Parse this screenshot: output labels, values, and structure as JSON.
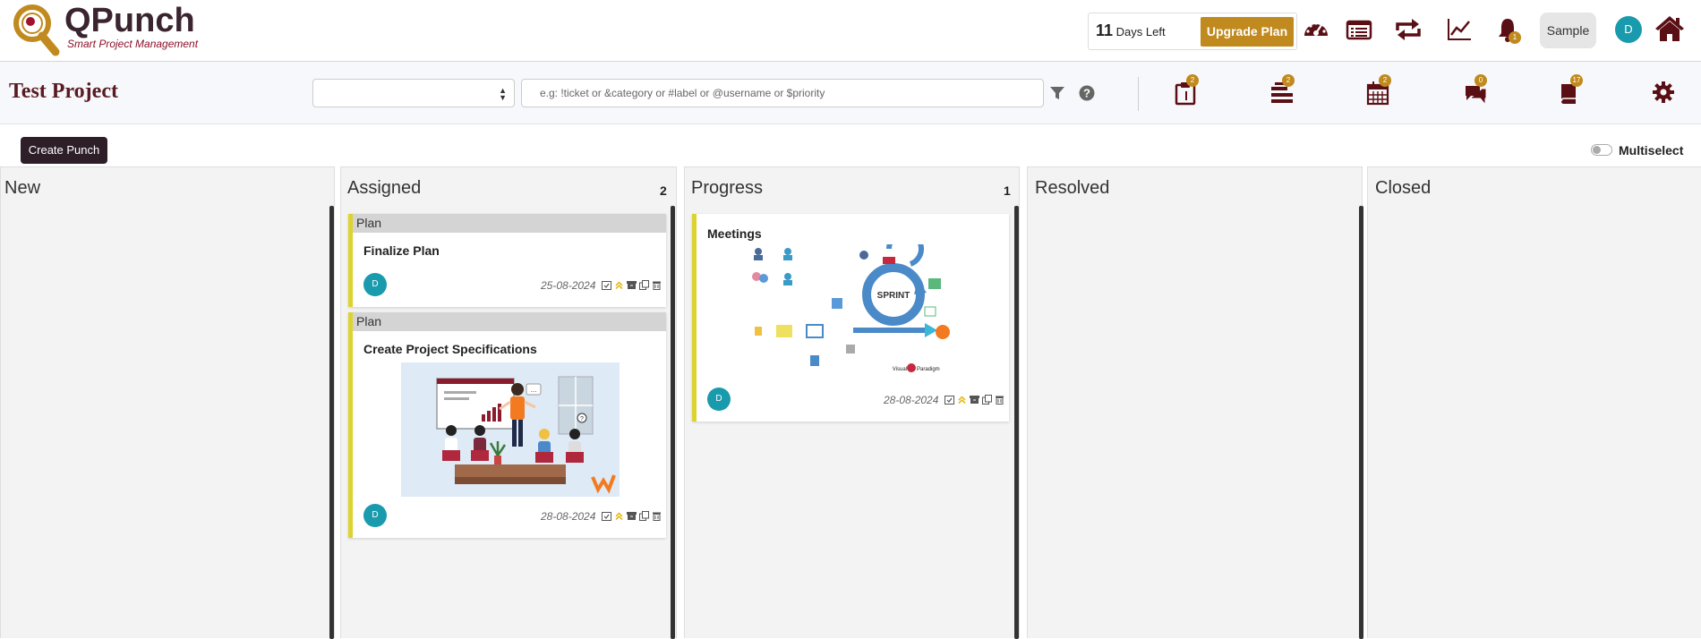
{
  "header": {
    "logo_word": "QPunch",
    "logo_tagline": "Smart Project Management",
    "days_left_number": "11",
    "days_left_label": "Days Left",
    "upgrade_label": "Upgrade Plan",
    "notification_count": "1",
    "sample_label": "Sample",
    "user_initial": "D",
    "icons": [
      "dashboard-icon",
      "list-icon",
      "sync-icon",
      "chart-icon",
      "bell-icon",
      "home-icon"
    ]
  },
  "project": {
    "title": "Test Project",
    "select_value": "",
    "search_placeholder": "e.g: !ticket or &category or #label or @username or $priority",
    "badges": {
      "clipboard": "2",
      "stack": "2",
      "calendar": "2",
      "chat": "0",
      "book": "17"
    }
  },
  "actions": {
    "create_label": "Create Punch",
    "multiselect_label": "Multiselect",
    "multiselect_on": false
  },
  "columns": [
    {
      "title": "New",
      "count": ""
    },
    {
      "title": "Assigned",
      "count": "2"
    },
    {
      "title": "Progress",
      "count": "1"
    },
    {
      "title": "Resolved",
      "count": ""
    },
    {
      "title": "Closed",
      "count": ""
    }
  ],
  "cards": {
    "finalize": {
      "category": "Plan",
      "title": "Finalize Plan",
      "date": "25-08-2024",
      "assignee": "D"
    },
    "specs": {
      "category": "Plan",
      "title": "Create Project Specifications",
      "date": "28-08-2024",
      "assignee": "D"
    },
    "meetings": {
      "title": "Meetings",
      "date": "28-08-2024",
      "assignee": "D",
      "image_text": {
        "sprint": "SPRINT",
        "brand": "Visual Paradigm"
      }
    }
  },
  "colors": {
    "accent_gold": "#c08a1e",
    "maroon": "#5a1a22",
    "avatar_teal": "#1a9aad",
    "card_stripe": "#dcd32e"
  }
}
